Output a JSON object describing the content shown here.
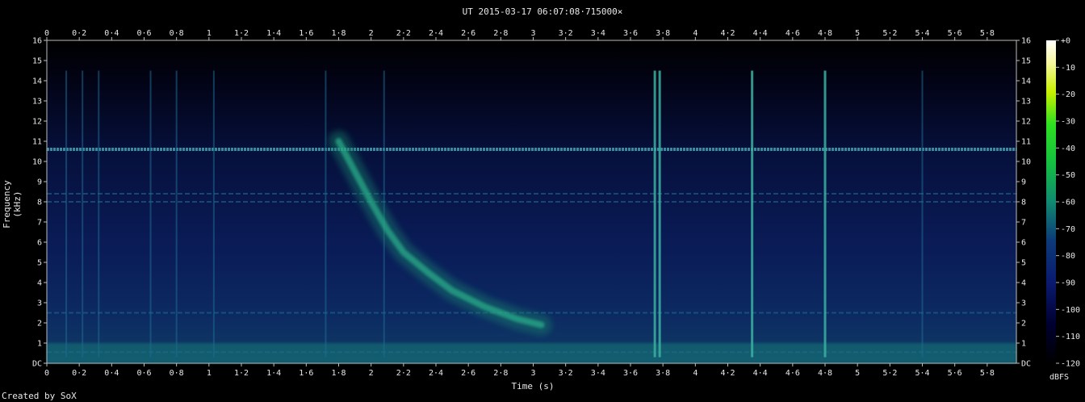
{
  "title": "UT 2015-03-17 06:07:08·715000×",
  "credit": "Created by SoX",
  "colors": {
    "background": "#000000",
    "axis": "#bdbdbd",
    "text": "#e8e8e8"
  },
  "chart_data": {
    "type": "heatmap",
    "title": "UT 2015-03-17 06:07:08·715000×",
    "xlabel": "Time (s)",
    "ylabel": "Frequency (kHz)",
    "xlim": [
      0,
      5.98
    ],
    "ylim": [
      0,
      16
    ],
    "x_tick_labels": [
      "0",
      "0·2",
      "0·4",
      "0·6",
      "0·8",
      "1",
      "1·2",
      "1·4",
      "1·6",
      "1·8",
      "2",
      "2·2",
      "2·4",
      "2·6",
      "2·8",
      "3",
      "3·2",
      "3·4",
      "3·6",
      "3·8",
      "4",
      "4·2",
      "4·4",
      "4·6",
      "4·8",
      "5",
      "5·2",
      "5·4",
      "5·6",
      "5·8"
    ],
    "y_tick_labels": [
      "DC",
      "1",
      "2",
      "3",
      "4",
      "5",
      "6",
      "7",
      "8",
      "9",
      "10",
      "11",
      "12",
      "13",
      "14",
      "15",
      "16"
    ],
    "colorbar": {
      "label": "dBFS",
      "ticks": [
        "+0",
        "-10",
        "-20",
        "-30",
        "-40",
        "-50",
        "-60",
        "-70",
        "-80",
        "-90",
        "-100",
        "-110",
        "-120"
      ],
      "range": [
        -120,
        0
      ]
    },
    "features": {
      "horizontal_tones_khz": [
        10.6,
        8.4,
        8.0,
        2.5,
        0.55
      ],
      "vertical_spikes_s": [
        0.12,
        0.22,
        0.32,
        0.64,
        0.8,
        1.03,
        1.72,
        2.08,
        3.75,
        3.78,
        4.35,
        4.8,
        5.4
      ],
      "whistler_curve": {
        "points": [
          [
            1.8,
            11
          ],
          [
            1.9,
            9.5
          ],
          [
            2.0,
            8.0
          ],
          [
            2.1,
            6.6
          ],
          [
            2.2,
            5.5
          ],
          [
            2.35,
            4.5
          ],
          [
            2.5,
            3.6
          ],
          [
            2.7,
            2.8
          ],
          [
            2.9,
            2.2
          ],
          [
            3.05,
            1.9
          ]
        ]
      }
    }
  }
}
